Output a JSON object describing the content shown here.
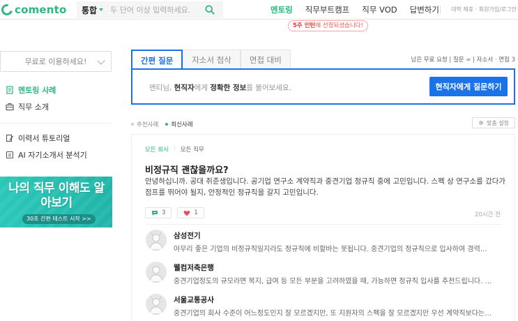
{
  "header": {
    "logo_text": "comento",
    "search_category": "통합",
    "search_placeholder": "두 단어 이상 입력하세요.",
    "nav": [
      "멘토링",
      "직무부트캠프",
      "직무 VOD",
      "답변하기"
    ],
    "nav_tip_strong": "5주 인턴",
    "nav_tip_rest": "에 선정되셨습니다!",
    "right_links": "대학 제휴 · 회원가입/로그인"
  },
  "sidebar": {
    "select_label": "무료로 이용하세요!",
    "items": [
      {
        "label": "멘토링 사례",
        "icon": "document-icon"
      },
      {
        "label": "직무 소개",
        "icon": "briefcase-icon"
      },
      {
        "label": "이력서 튜토리얼",
        "icon": "edit-icon"
      },
      {
        "label": "AI 자기소개서 분석기",
        "icon": "ai-icon"
      }
    ],
    "banner_title": "나의 직무 이해도 알아보기",
    "banner_button": "30초 간편 테스트 시작 >>"
  },
  "main": {
    "tabs": [
      "간편 질문",
      "자소서 첨삭",
      "면접 대비"
    ],
    "tab_right": "남은 무료 요청 | 질문 ∞ | 자소서 · 면접 3",
    "ask_prefix": "멘티님, ",
    "ask_strong1": "현직자",
    "ask_mid": "에게 ",
    "ask_strong2": "정확한 정보",
    "ask_suffix": "를 물어보세요.",
    "ask_button": "현직자에게 질문하기",
    "filters": [
      "추천사례",
      "최신사례"
    ],
    "custom_button": "맞춤 설정"
  },
  "post": {
    "tag1": "모든 회사",
    "tag2": "모든 직무",
    "title": "비정규직 괜찮을까요?",
    "body": "안녕하십니까. 공대 취준생입니다. 공기업 연구소 계약직과 중견기업 정규직 중에 고민입니다. 스펙 상 연구소를 갔다가 점프를 뛰어야 될지, 안정적인 정규직을 갈지 고민입니다.",
    "comments": "3",
    "likes": "1",
    "time": "20시간 전",
    "answers": [
      {
        "company": "삼성전기",
        "text": "아무리 좋은 기업의 비정규직일지라도 정규직에 비할바는 못됩니다. 중견기업의 정규직으로 입사하여 경력…"
      },
      {
        "company": "웰컴저축은행",
        "text": "중견기업정도의 규모라면 복지, 급여 등 모든 부분을 고려하였을 때, 가능하면 정규직 입사를 추천드립니다. …"
      },
      {
        "company": "서울교통공사",
        "text": "중견기업의 회사 수준이 어느정도인지 잘 모르겠지만, 또 지원자의 스펙을 잘 모르겠지만 우선 계약직보다는…"
      }
    ]
  },
  "colors": {
    "brand_green": "#2cb87e",
    "primary_blue": "#1a73e8",
    "banner_teal": "#2bc8b9"
  }
}
